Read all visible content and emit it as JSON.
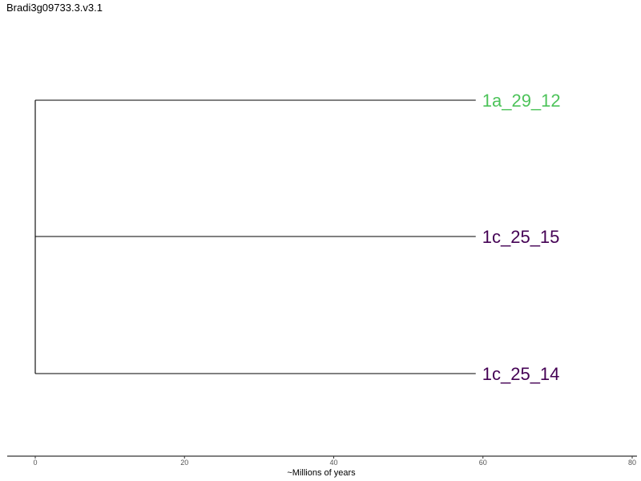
{
  "title": "Bradi3g09733.3.v3.1",
  "chart_data": {
    "type": "phylogenetic-tree",
    "title": "Bradi3g09733.3.v3.1",
    "xlabel": "~Millions of years",
    "xlim": [
      0,
      80
    ],
    "x_ticks": [
      0,
      20,
      40,
      60,
      80
    ],
    "tips": [
      {
        "label": "1a_29_12",
        "age": 60,
        "color": "#4dc35a"
      },
      {
        "label": "1c_25_15",
        "age": 60,
        "color": "#440154"
      },
      {
        "label": "1c_25_14",
        "age": 60,
        "color": "#440154"
      }
    ],
    "root_age": 0
  }
}
